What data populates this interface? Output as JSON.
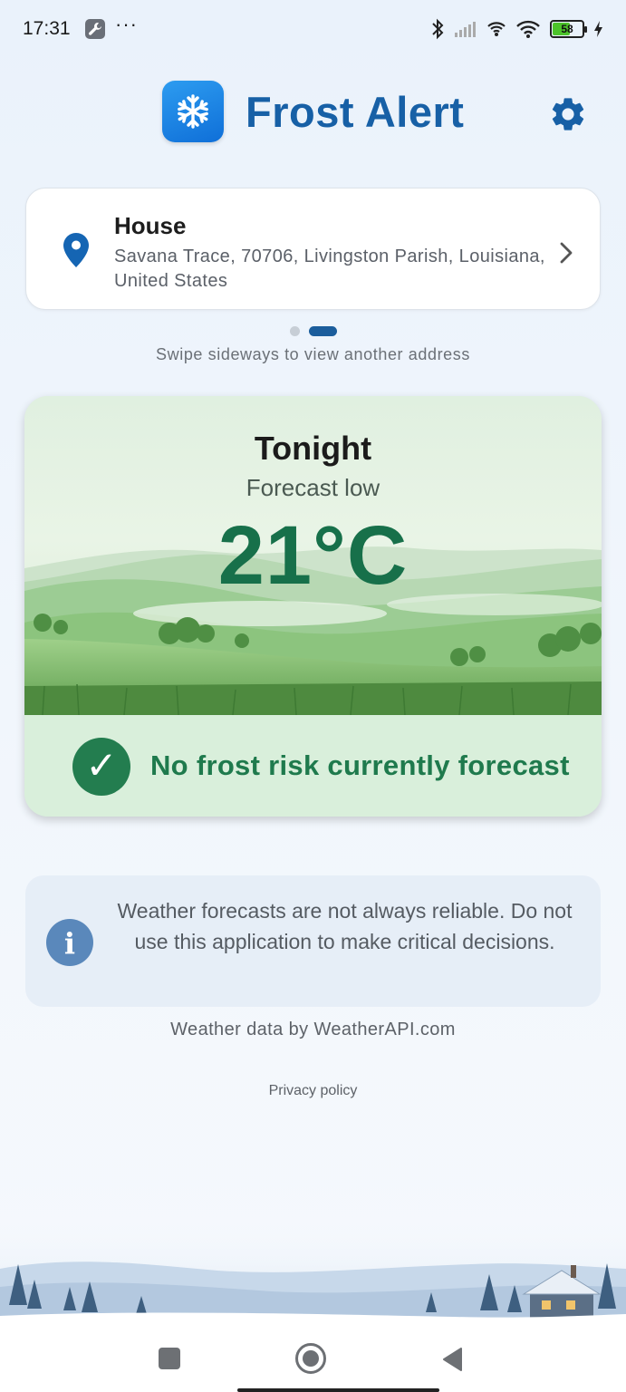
{
  "status_bar": {
    "time": "17:31",
    "overflow": "···",
    "battery_level": "58",
    "battery_fraction": 0.58,
    "icons": [
      "tool-icon",
      "bluetooth-icon",
      "signal-icon",
      "hotspot-icon",
      "wifi-icon",
      "battery-icon",
      "charging-icon"
    ]
  },
  "header": {
    "title": "Frost Alert",
    "logo_icon": "snowflake-icon",
    "settings_icon": "gear-icon"
  },
  "address": {
    "name": "House",
    "line": "Savana Trace, 70706, Livingston Parish, Louisiana, United States",
    "page_count": 2,
    "active_page": 2,
    "swipe_hint": "Swipe sideways to view another address"
  },
  "forecast": {
    "period": "Tonight",
    "label": "Forecast low",
    "temperature": "21°C",
    "status": "No frost risk currently forecast",
    "status_icon": "check-icon",
    "accent_color": "#17704a"
  },
  "disclaimer": {
    "text": "Weather forecasts are not always reliable. Do not use this application to make critical decisions.",
    "icon": "info-icon"
  },
  "footer": {
    "credit": "Weather data by WeatherAPI.com",
    "privacy": "Privacy policy"
  },
  "colors": {
    "brand": "#1760a6",
    "background": "#eef4fb",
    "card_green": "#dcefdc"
  }
}
